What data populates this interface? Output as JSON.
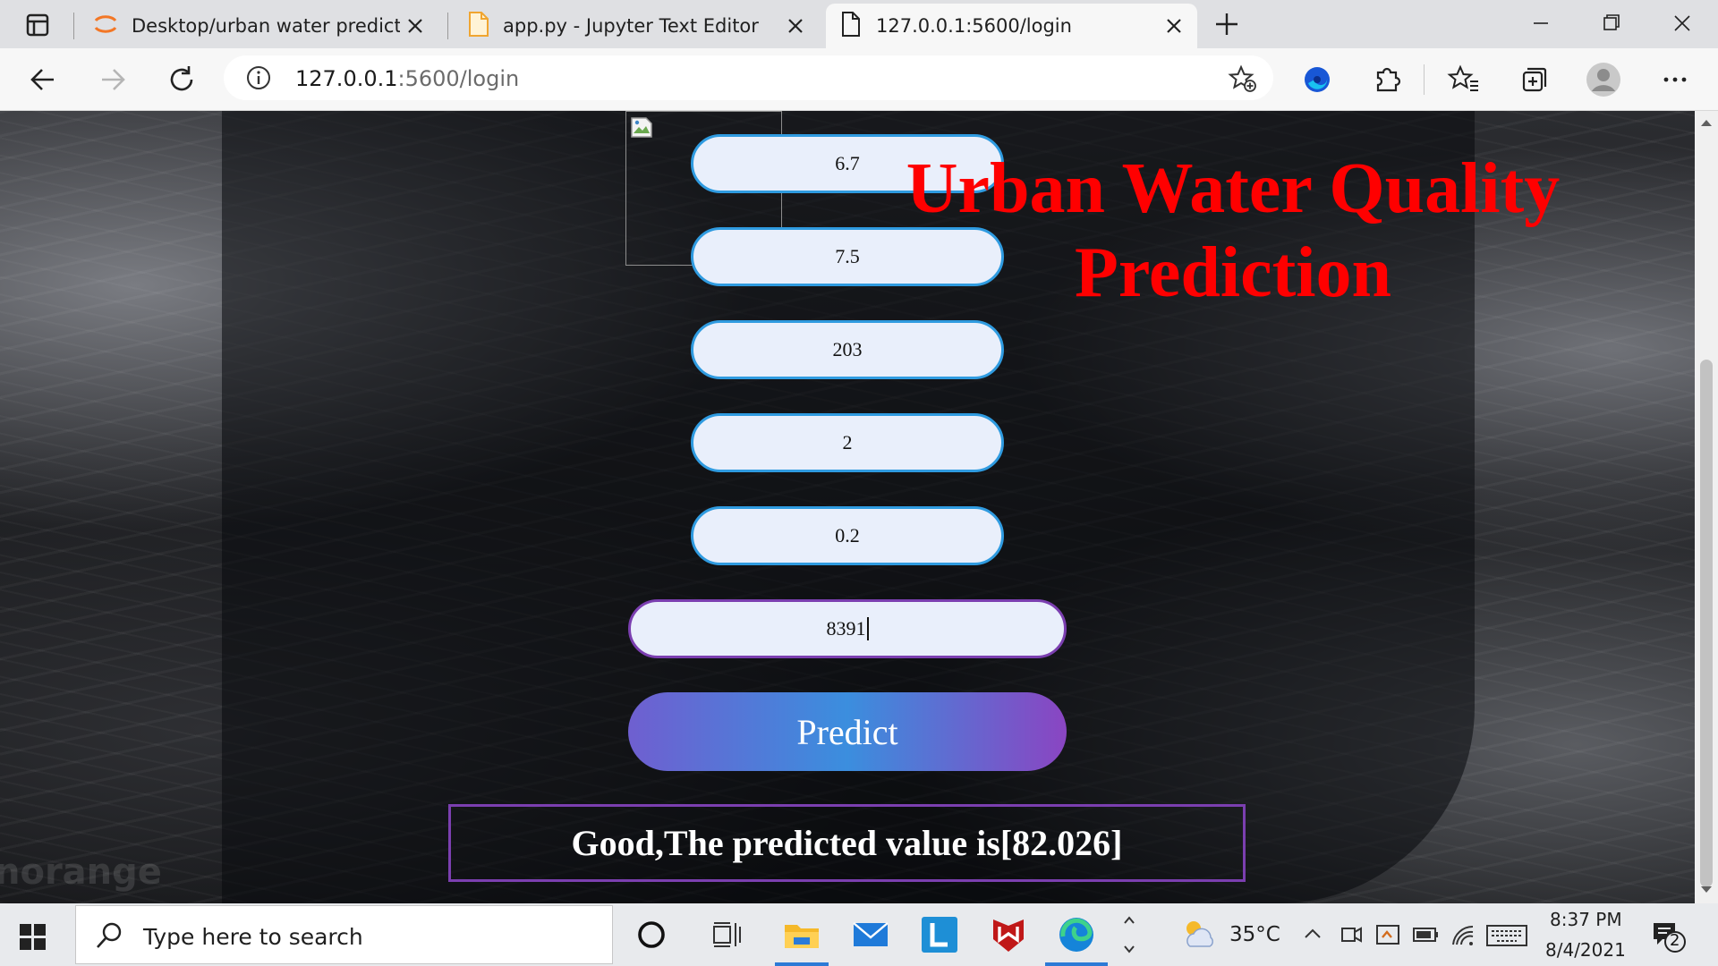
{
  "browser": {
    "tabs": [
      {
        "label": "Desktop/urban water prediction/",
        "icon": "jupyter-icon"
      },
      {
        "label": "app.py - Jupyter Text Editor",
        "icon": "file-icon"
      },
      {
        "label": "127.0.0.1:5600/login",
        "icon": "page-icon",
        "active": true
      }
    ],
    "url_host": "127.0.0.1",
    "url_rest": ":5600/login"
  },
  "page": {
    "title": "Urban Water Quality Prediction",
    "inputs": [
      {
        "value": "6.7"
      },
      {
        "value": "7.5"
      },
      {
        "value": "203"
      },
      {
        "value": "2"
      },
      {
        "value": "0.2"
      },
      {
        "value": "8391"
      }
    ],
    "predict_label": "Predict",
    "result_text": "Good,The predicted value is[82.026]",
    "watermark": "norange"
  },
  "taskbar": {
    "search_placeholder": "Type here to search",
    "weather": "35°C",
    "time": "8:37 PM",
    "date": "8/4/2021",
    "notification_count": "2"
  },
  "colors": {
    "title_red": "#ff0000",
    "field_border_blue": "#2f9be0",
    "field_border_purple": "#7b3fb0"
  }
}
